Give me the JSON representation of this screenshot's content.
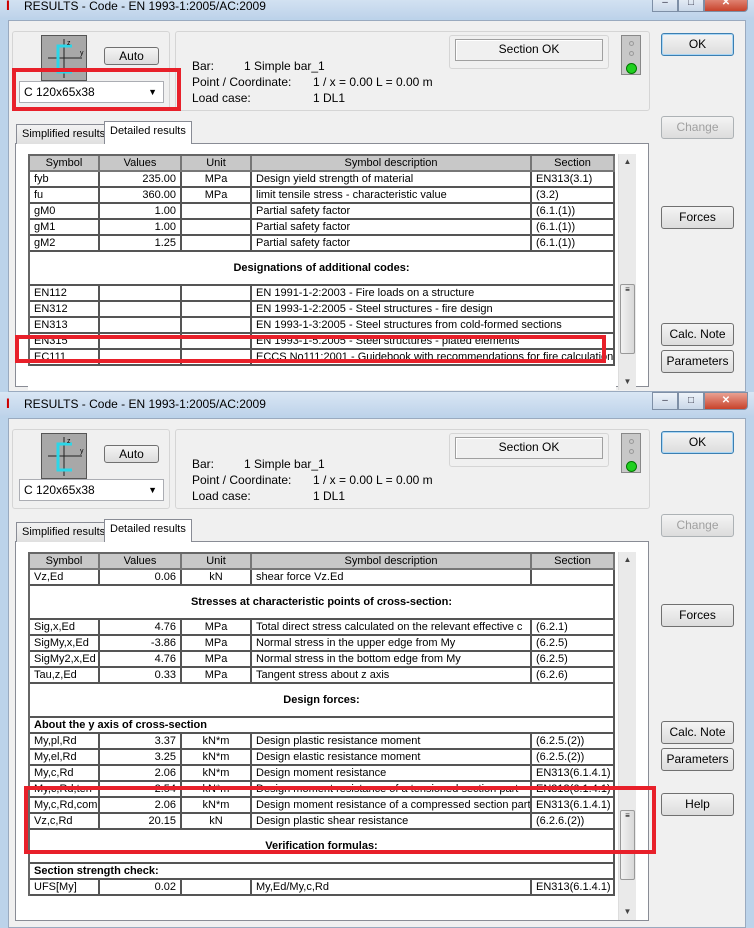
{
  "windows": [
    {
      "title": "RESULTS - Code - EN 1993-1:2005/AC:2009",
      "auto_label": "Auto",
      "section_value": "C 120x65x38",
      "bar_label": "Bar:",
      "bar_value": "1  Simple bar_1",
      "point_label": "Point / Coordinate:",
      "point_value": "1 / x = 0.00 L = 0.00 m",
      "load_label": "Load case:",
      "load_value": "1 DL1",
      "status": "Section OK",
      "buttons": {
        "ok": "OK",
        "change": "Change",
        "forces": "Forces",
        "calc_note": "Calc. Note",
        "parameters": "Parameters"
      },
      "tabs": [
        "Simplified results",
        "Detailed results"
      ],
      "columns": [
        "Symbol",
        "Values",
        "Unit",
        "Symbol description",
        "Section"
      ],
      "rows": [
        {
          "t": "d",
          "c": [
            "fyb",
            "235.00",
            "MPa",
            "Design yield strength of material",
            "EN313(3.1)"
          ]
        },
        {
          "t": "d",
          "c": [
            "fu",
            "360.00",
            "MPa",
            "limit tensile stress - characteristic value",
            "(3.2)"
          ]
        },
        {
          "t": "d",
          "c": [
            "gM0",
            "1.00",
            "",
            "Partial safety factor",
            "(6.1.(1))"
          ]
        },
        {
          "t": "d",
          "c": [
            "gM1",
            "1.00",
            "",
            "Partial safety factor",
            "(6.1.(1))"
          ]
        },
        {
          "t": "d",
          "c": [
            "gM2",
            "1.25",
            "",
            "Partial safety factor",
            "(6.1.(1))"
          ]
        },
        {
          "t": "h",
          "c": [
            "Designations of additional codes:"
          ]
        },
        {
          "t": "w",
          "c": [
            "EN112",
            "",
            "",
            "EN 1991-1-2:2003 - Fire loads on a structure"
          ]
        },
        {
          "t": "w",
          "c": [
            "EN312",
            "",
            "",
            "EN 1993-1-2:2005 - Steel structures - fire design"
          ]
        },
        {
          "t": "w",
          "c": [
            "EN313",
            "",
            "",
            "EN 1993-1-3:2005 - Steel structures from cold-formed sections"
          ]
        },
        {
          "t": "w",
          "c": [
            "EN315",
            "",
            "",
            "EN 1993-1-5:2005 - Steel structures - plated elements"
          ]
        },
        {
          "t": "w",
          "c": [
            "EC111",
            "",
            "",
            "ECCS No111:2001 - Guidebook with recommendations for fire calculation"
          ]
        }
      ]
    },
    {
      "title": "RESULTS - Code - EN 1993-1:2005/AC:2009",
      "auto_label": "Auto",
      "section_value": "C 120x65x38",
      "bar_label": "Bar:",
      "bar_value": "1  Simple bar_1",
      "point_label": "Point / Coordinate:",
      "point_value": "1 / x = 0.00 L = 0.00 m",
      "load_label": "Load case:",
      "load_value": "1 DL1",
      "status": "Section OK",
      "buttons": {
        "ok": "OK",
        "change": "Change",
        "forces": "Forces",
        "calc_note": "Calc. Note",
        "parameters": "Parameters",
        "help": "Help"
      },
      "tabs": [
        "Simplified results",
        "Detailed results"
      ],
      "columns": [
        "Symbol",
        "Values",
        "Unit",
        "Symbol description",
        "Section"
      ],
      "rows": [
        {
          "t": "d",
          "c": [
            "Vz,Ed",
            "0.06",
            "kN",
            "shear force Vz.Ed",
            ""
          ]
        },
        {
          "t": "h",
          "c": [
            "Stresses at characteristic points of cross-section:"
          ]
        },
        {
          "t": "d",
          "c": [
            "Sig,x,Ed",
            "4.76",
            "MPa",
            "Total direct stress calculated on the relevant effective c",
            "(6.2.1)"
          ]
        },
        {
          "t": "d",
          "c": [
            "SigMy,x,Ed",
            "-3.86",
            "MPa",
            "Normal stress in the upper edge from My",
            "(6.2.5)"
          ]
        },
        {
          "t": "d",
          "c": [
            "SigMy2,x,Ed",
            "4.76",
            "MPa",
            "Normal stress in the bottom edge from My",
            "(6.2.5)"
          ]
        },
        {
          "t": "d",
          "c": [
            "Tau,z,Ed",
            "0.33",
            "MPa",
            "Tangent stress about z axis",
            "(6.2.6)"
          ]
        },
        {
          "t": "h",
          "c": [
            "Design forces:"
          ]
        },
        {
          "t": "s",
          "c": [
            "About the y axis of cross-section"
          ]
        },
        {
          "t": "d",
          "c": [
            "My,pl,Rd",
            "3.37",
            "kN*m",
            "Design plastic resistance moment",
            "(6.2.5.(2))"
          ]
        },
        {
          "t": "d",
          "c": [
            "My,el,Rd",
            "3.25",
            "kN*m",
            "Design elastic resistance moment",
            "(6.2.5.(2))"
          ]
        },
        {
          "t": "d",
          "c": [
            "My,c,Rd",
            "2.06",
            "kN*m",
            "Design moment resistance",
            "EN313(6.1.4.1)"
          ]
        },
        {
          "t": "d",
          "c": [
            "My,c,Rd,ten",
            "2.54",
            "kN*m",
            "Design moment resistance of a tensioned section part",
            "EN313(6.1.4.1)"
          ]
        },
        {
          "t": "d",
          "c": [
            "My,c,Rd,com",
            "2.06",
            "kN*m",
            "Design moment resistance of a compressed section part",
            "EN313(6.1.4.1)"
          ]
        },
        {
          "t": "d",
          "c": [
            "Vz,c,Rd",
            "20.15",
            "kN",
            "Design plastic shear resistance",
            "(6.2.6.(2))"
          ]
        },
        {
          "t": "h",
          "c": [
            "Verification formulas:"
          ]
        },
        {
          "t": "s",
          "c": [
            "Section strength check:"
          ]
        },
        {
          "t": "d",
          "c": [
            "UFS[My]",
            "0.02",
            "",
            "My,Ed/My,c,Rd",
            "EN313(6.1.4.1)"
          ]
        }
      ]
    }
  ]
}
